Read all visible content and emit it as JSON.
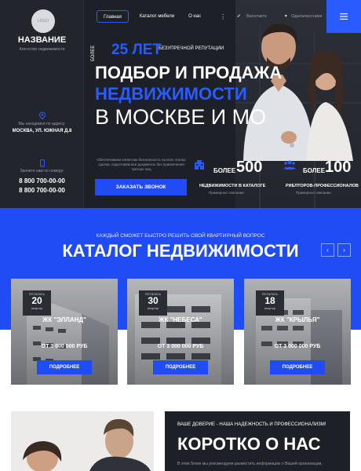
{
  "header": {
    "logo_text": "LOGO",
    "brand": "НАЗВАНИЕ",
    "brand_sub": "Агентство недвижимости",
    "address_label": "Мы находимся по адресу:",
    "address": "МОСКВА, УЛ. ЮЖНАЯ Д.8",
    "phone_label": "Звоните нам по номеру:",
    "phones": [
      "8 800 700-00-00",
      "8 800 700-00-00"
    ],
    "nav": [
      "Главная",
      "Каталог мебели",
      "О нас"
    ],
    "social": [
      "Вконтакте",
      "Одноклассники"
    ]
  },
  "hero": {
    "vertical": "БОЛЕЕ",
    "years": "25 ЛЕТ",
    "years_sub": "БЕЗУПРЕЧНОЙ РЕПУТАЦИИ",
    "line1": "ПОДБОР И ПРОДАЖА",
    "line2": "НЕДВИЖИМОСТИ",
    "line3": "В МОСКВЕ И МО",
    "desc": "Обеспечиваем клиентам безопасность на всех этапах сделки, подготовим все документы без привлечения третьих лиц",
    "cta": "ЗАКАЗАТЬ ЗВОНОК",
    "stats": [
      {
        "word": "БОЛЕЕ",
        "num": "500",
        "cap": "НЕДВИЖИМОСТИ В КАТАЛОГЕ",
        "sub": "Примерное описание"
      },
      {
        "word": "БОЛЕЕ",
        "num": "100",
        "cap": "РИЕЛТОРОВ-ПРОФЕССИОНАЛОВ",
        "sub": "Примерное описание"
      }
    ]
  },
  "catalog": {
    "kicker": "КАЖДЫЙ СМОЖЕТ БЫСТРО РЕШИТЬ СВОЙ КВАРТИРНЫЙ ВОПРОС",
    "title": "КАТАЛОГ НЕДВИЖИМОСТИ",
    "prev": "‹",
    "next": "›",
    "cards": [
      {
        "badge_top": "Осталось",
        "badge_num": "20",
        "badge_bot": "квартир",
        "name": "ЖК \"ЭЛЛАНД\"",
        "price": "ОТ 3 000 000 РУБ",
        "button": "ПОДРОБНЕЕ"
      },
      {
        "badge_top": "Осталось",
        "badge_num": "30",
        "badge_bot": "квартир",
        "name": "ЖК \"НЕБЕСА\"",
        "price": "ОТ 3 000 000 РУБ",
        "button": "ПОДРОБНЕЕ"
      },
      {
        "badge_top": "Осталось",
        "badge_num": "18",
        "badge_bot": "квартир",
        "name": "ЖК \"КРЫЛЬЯ\"",
        "price": "ОТ 3 000 000 РУБ",
        "button": "ПОДРОБНЕЕ"
      }
    ]
  },
  "about": {
    "kicker": "ВАШЕ ДОВЕРИЕ - НАША НАДЕЖНОСТЬ И ПРОФЕССИОНАЛИЗМ!",
    "title": "КОРОТКО О НАС",
    "text": "В этом блоке мы рекомендуем разместить информацию о Вашей организации,"
  },
  "colors": {
    "accent": "#1f4cf5",
    "dark": "#1d2027"
  },
  "icons": {
    "location": "location-icon",
    "phone": "phone-icon",
    "menu": "hamburger-icon",
    "stat1": "building-icon",
    "stat2": "team-icon"
  }
}
